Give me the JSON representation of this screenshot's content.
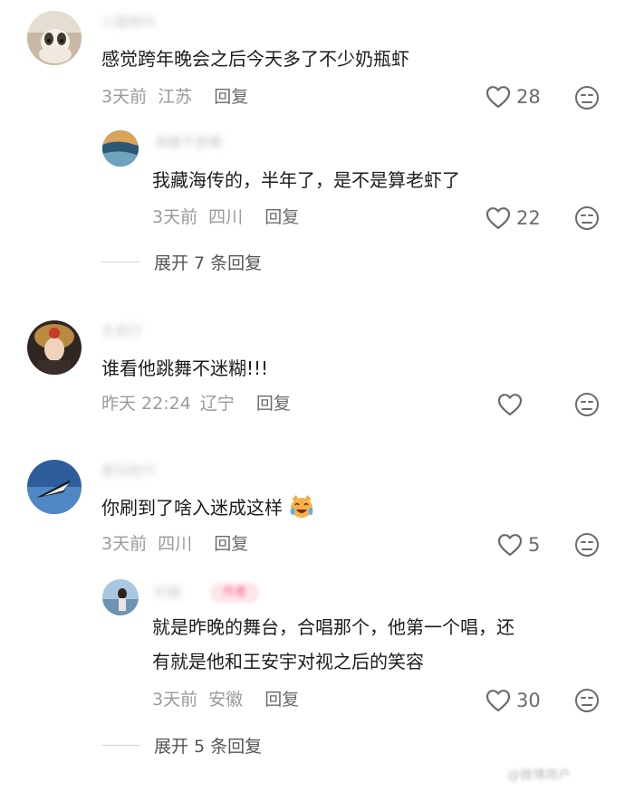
{
  "comments": [
    {
      "username": "小猫咪叫",
      "text": "感觉跨年晚会之后今天多了不少奶瓶虾",
      "time": "3天前",
      "location": "江苏",
      "reply_label": "回复",
      "likes": "28",
      "replies": [
        {
          "username": "海螺不是螺",
          "text": "我藏海传的，半年了，是不是算老虾了",
          "time": "3天前",
          "location": "四川",
          "reply_label": "回复",
          "likes": "22"
        }
      ],
      "expand_label": "展开 7 条回复"
    },
    {
      "username": "东君行",
      "text": "谁看他跳舞不迷糊!!!",
      "time": "昨天 22:24",
      "location": "辽宁",
      "reply_label": "回复",
      "likes": ""
    },
    {
      "username": "星际航行",
      "text": "你刷到了啥入迷成这样",
      "emoji": "cat-laughing-emoji",
      "time": "3天前",
      "location": "四川",
      "reply_label": "回复",
      "likes": "5",
      "replies": [
        {
          "username": "柠檬",
          "badge": "作者",
          "text_line1": "就是昨晚的舞台，合唱那个，他第一个唱，还",
          "text_line2": "有就是他和王安宇对视之后的笑容",
          "time": "3天前",
          "location": "安徽",
          "reply_label": "回复",
          "likes": "30"
        }
      ],
      "expand_label": "展开 5 条回复"
    }
  ],
  "watermark": "@微博用户",
  "colors": {
    "heart": "#6b6b6b",
    "meta": "#9a9a9a",
    "badge": "#ff6b8b"
  }
}
